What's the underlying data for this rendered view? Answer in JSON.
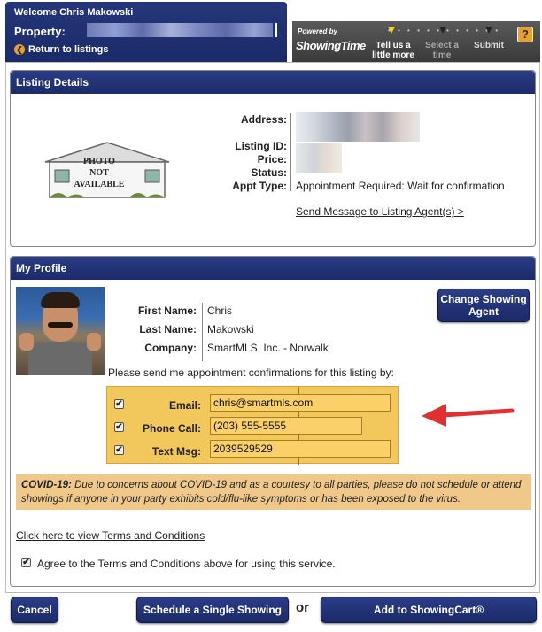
{
  "header": {
    "welcome": "Welcome Chris Makowski",
    "property_label": "Property:",
    "return_link": "Return to listings",
    "powered_by": "Powered by",
    "brand": "ShowingTime",
    "steps": [
      {
        "label": "Tell us a little more",
        "state": "current"
      },
      {
        "label": "Select a time",
        "state": "upcoming"
      },
      {
        "label": "Submit",
        "state": "upcoming"
      }
    ],
    "help": "?"
  },
  "listing": {
    "title": "Listing Details",
    "photo_text": "PHOTO NOT AVAILABLE",
    "address_label": "Address:",
    "listing_id_label": "Listing ID:",
    "price_label": "Price:",
    "status_label": "Status:",
    "appt_type_label": "Appt Type:",
    "appt_type_value": "Appointment Required: Wait for confirmation",
    "send_message": "Send Message to Listing Agent(s) >"
  },
  "profile": {
    "title": "My Profile",
    "first_name_label": "First Name:",
    "first_name": "Chris",
    "last_name_label": "Last Name:",
    "last_name": "Makowski",
    "company_label": "Company:",
    "company": "SmartMLS, Inc. - Norwalk",
    "change_agent": "Change Showing Agent",
    "send_confirm": "Please send me appointment confirmations for this listing by:",
    "email_label": "Email:",
    "email": "chris@smartmls.com",
    "phone_label": "Phone Call:",
    "phone": "(203) 555-5555",
    "text_label": "Text Msg:",
    "text": "2039529529",
    "covid_label": "COVID-19:",
    "covid_text": " Due to concerns about COVID-19 and as a courtesy to all parties, please do not schedule or attend showings if anyone in your party exhibits cold/flu-like symptoms or has been exposed to the virus.",
    "terms_link": "Click here to view Terms and Conditions",
    "agree": "Agree to the Terms and Conditions above for using this service."
  },
  "buttons": {
    "cancel": "Cancel",
    "schedule_single": "Schedule a Single Showing",
    "or": "or",
    "add_cart": "Add to ShowingCart®"
  },
  "colors": {
    "navy": "#1b2a68",
    "highlight": "#f2c85c",
    "covid_bg": "#f0c88a",
    "arrow": "#e03030"
  }
}
